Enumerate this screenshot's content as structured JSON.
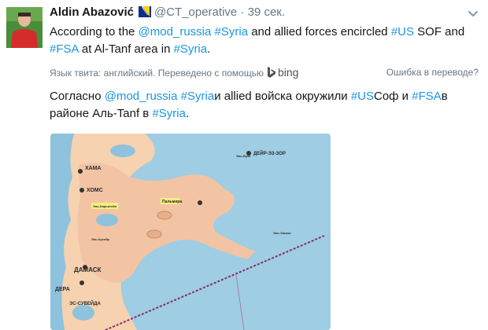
{
  "tweet": {
    "author_name": "Aldin Abazović",
    "handle": "@CT_operative",
    "separator": "·",
    "time": "39 сек.",
    "text_line1": [
      "According to the ",
      "@mod_russia",
      " ",
      "#Syria",
      " and allied forces encircled ",
      "#US",
      " SOF and"
    ],
    "text_line2": [
      "#FSA",
      " at Al-Tanf area in ",
      "#Syria",
      "."
    ],
    "translation_note": "Язык твита: английский. Переведено с помощью",
    "translator_name": "bing",
    "translation_error_link": "Ошибка в переводе?",
    "translated_line1": [
      "Согласно ",
      "@mod_russia",
      " ",
      "#Syria",
      "и allied войска окружили ",
      "#US",
      "Соф и ",
      "#FSA",
      "в"
    ],
    "translated_line2": [
      "районе Аль-Tanf в ",
      "#Syria",
      "."
    ]
  },
  "map": {
    "labels": {
      "kama": "ХАМА",
      "homs": "ХОМС",
      "palmyra": "Пальмира",
      "deir": "ДЕЙР-ЭЗ-ЗОР",
      "damascus": "ДАМАСК",
      "deraa": "ДЕРА",
      "suwayda": "ЭС-СУВЕЙДА",
      "small1": "Эль-Карьятейн",
      "small2": "Эль-Кусейр",
      "small3": "Эль-Бухе",
      "small4": "Эль-Хасакэ"
    }
  },
  "colors": {
    "link": "#1b95e0",
    "meta": "#657786",
    "map_water": "#9fcde3",
    "map_land": "#f6d2b0",
    "map_territory": "#f2c4a4",
    "map_border": "#8a2b6b"
  },
  "icons": {
    "flag": "bosnia-flag-icon",
    "chevron": "chevron-down-icon",
    "bing": "bing-logo-icon"
  }
}
